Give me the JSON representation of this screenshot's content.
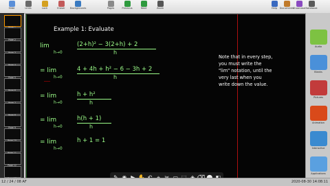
{
  "toolbar": {
    "items": [
      {
        "label": "Slide",
        "icon": "slide-icon",
        "color": "#5a8fd8"
      },
      {
        "label": "Links",
        "icon": "links-icon",
        "color": "#6a6a6a"
      },
      {
        "label": "Lock",
        "icon": "lock-icon",
        "color": "#d4a020"
      },
      {
        "label": "Eraser",
        "icon": "eraser-icon",
        "color": "#c25a5a"
      },
      {
        "label": "Backgrounds",
        "icon": "backgrounds-icon",
        "color": "#3a7ac0"
      },
      {
        "label": "Pages",
        "icon": "pages-icon",
        "color": "#8a8a8a"
      },
      {
        "label": "Previous",
        "icon": "previous-icon",
        "color": "#2e9a3e"
      },
      {
        "label": "Next",
        "icon": "next-icon",
        "color": "#2e9a3e"
      },
      {
        "label": "Zoom",
        "icon": "zoom-icon",
        "color": "#555555"
      },
      {
        "label": "Help",
        "icon": "help-icon",
        "color": "#3a6ac0"
      },
      {
        "label": "Documents",
        "icon": "documents-icon",
        "color": "#c07a2a"
      },
      {
        "label": "Showcase",
        "icon": "showcase-icon",
        "color": "#8a4ac0"
      },
      {
        "label": "Notebook",
        "icon": "notebook-icon",
        "color": "#5a5a5a"
      }
    ]
  },
  "sidebar": {
    "pages": [
      "Page 1",
      "Page 2",
      "Page 3",
      "Page 4",
      "Page 5",
      "Page 6",
      "Page 7",
      "Page 8",
      "Page 9",
      "Page 10",
      "Page 11",
      "Page 12",
      "Page 13"
    ]
  },
  "board": {
    "title": "Example 1: Evaluate",
    "lines": [
      {
        "lhs": "lim\nh→0",
        "num": "(2+h)² − 3(2+h) + 2",
        "den": "h"
      },
      {
        "lhs": "= lim\nh→0",
        "num": "4 + 4h + h² − 6 − 3h + 2",
        "den": "h"
      },
      {
        "lhs": "= lim\nh→0",
        "num": "h + h²",
        "den": "h"
      },
      {
        "lhs": "= lim\nh→0",
        "num": "h(h + 1)",
        "den": "h"
      },
      {
        "lhs": "= lim\nh→0",
        "num": "h + 1  =  1",
        "den": ""
      }
    ],
    "note": "Note that in every step, you must write the \"lim\" notation, until the very last when you write down the value."
  },
  "gallery": {
    "items": [
      {
        "label": "Audio",
        "color": "#7dc242"
      },
      {
        "label": "Blanks",
        "color": "#4a90d9"
      },
      {
        "label": "Pictures",
        "color": "#c23b3b"
      },
      {
        "label": "Animation",
        "color": "#d94a1a"
      },
      {
        "label": "Interactive",
        "color": "#3a8ad0"
      },
      {
        "label": "Applications",
        "color": "#5aa0e0"
      }
    ]
  },
  "tray": {
    "tools": [
      "✎",
      "◉",
      "▶",
      "✋",
      "↶",
      "⌖",
      "✂",
      "▭",
      "⬚",
      "◈",
      "⌫",
      "⬤",
      "◧"
    ]
  },
  "status": {
    "left": "12 / 24 / 08 AF",
    "right": "2020-08-30  14:08:11"
  }
}
